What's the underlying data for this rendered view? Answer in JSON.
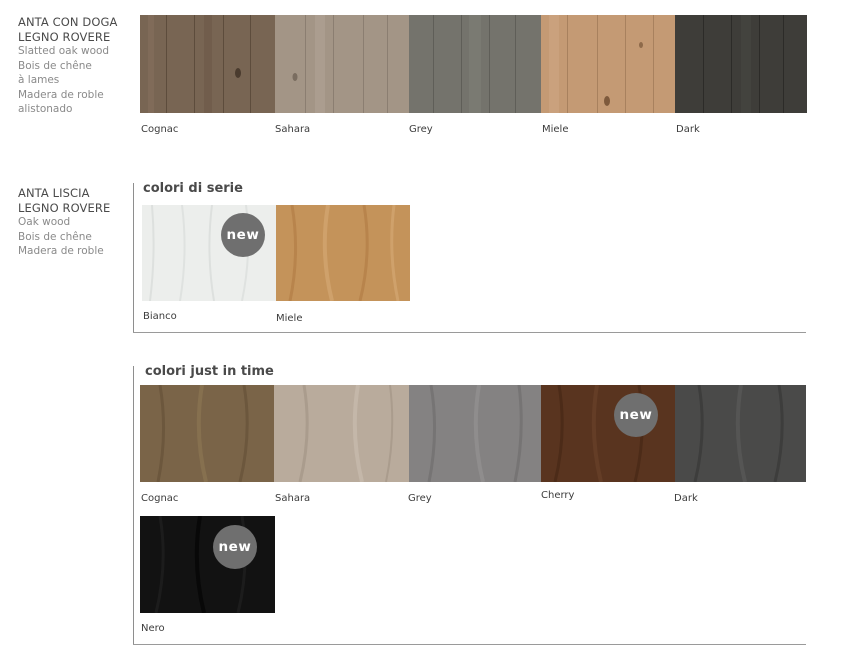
{
  "section1": {
    "title1": "ANTA CON DOGA",
    "title2": "LEGNO ROVERE",
    "sub": [
      "Slatted oak wood",
      "Bois de chêne",
      "à lames",
      "Madera de roble",
      "alistonado"
    ],
    "swatches": [
      {
        "label": "Cognac",
        "color": "#786553"
      },
      {
        "label": "Sahara",
        "color": "#a39586"
      },
      {
        "label": "Grey",
        "color": "#74736c"
      },
      {
        "label": "Miele",
        "color": "#c49a74"
      },
      {
        "label": "Dark",
        "color": "#3e3d39"
      }
    ]
  },
  "section2": {
    "title1": "ANTA LISCIA",
    "title2": "LEGNO ROVERE",
    "sub": [
      "Oak wood",
      "Bois de chêne",
      "Madera de roble"
    ],
    "header": "colori di serie",
    "badge": "new",
    "swatches": [
      {
        "label": "Bianco",
        "color": "#eceeec"
      },
      {
        "label": "Miele",
        "color": "#c4935a"
      }
    ]
  },
  "section3": {
    "header": "colori just in time",
    "badge": "new",
    "swatches": [
      {
        "label": "Cognac",
        "color": "#7a6448"
      },
      {
        "label": "Sahara",
        "color": "#b9ab9c"
      },
      {
        "label": "Grey",
        "color": "#848282"
      },
      {
        "label": "Cherry",
        "color": "#59341f"
      },
      {
        "label": "Dark",
        "color": "#4a4a49"
      },
      {
        "label": "Nero",
        "color": "#121212"
      }
    ]
  }
}
